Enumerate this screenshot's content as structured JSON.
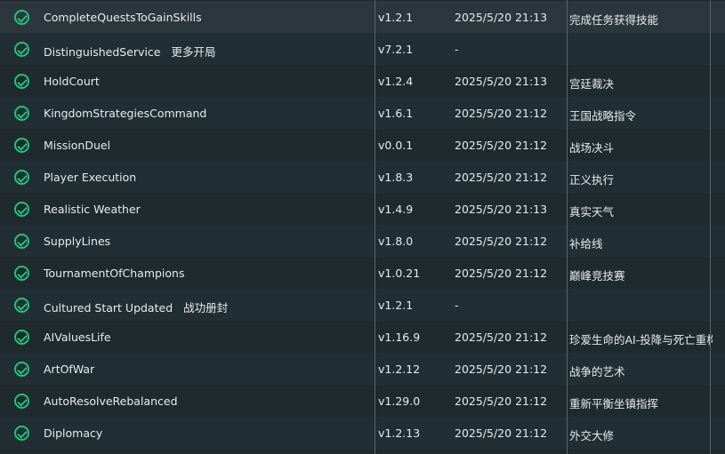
{
  "mods": [
    {
      "name": "CompleteQuestsToGainSkills",
      "extra": "",
      "version": "v1.2.1",
      "date": "2025/5/20 21:13",
      "desc": "完成任务获得技能"
    },
    {
      "name": "DistinguishedService",
      "extra": "更多开局",
      "version": "v7.2.1",
      "date": "-",
      "desc": ""
    },
    {
      "name": "HoldCourt",
      "extra": "",
      "version": "v1.2.4",
      "date": "2025/5/20 21:13",
      "desc": "宫廷裁决"
    },
    {
      "name": "KingdomStrategiesCommand",
      "extra": "",
      "version": "v1.6.1",
      "date": "2025/5/20 21:12",
      "desc": "王国战略指令"
    },
    {
      "name": "MissionDuel",
      "extra": "",
      "version": "v0.0.1",
      "date": "2025/5/20 21:12",
      "desc": "战场决斗"
    },
    {
      "name": "Player Execution",
      "extra": "",
      "version": "v1.8.3",
      "date": "2025/5/20 21:12",
      "desc": "正义执行"
    },
    {
      "name": "Realistic Weather",
      "extra": "",
      "version": "v1.4.9",
      "date": "2025/5/20 21:13",
      "desc": "真实天气"
    },
    {
      "name": "SupplyLines",
      "extra": "",
      "version": "v1.8.0",
      "date": "2025/5/20 21:12",
      "desc": "补给线"
    },
    {
      "name": "TournamentOfChampions",
      "extra": "",
      "version": "v1.0.21",
      "date": "2025/5/20 21:12",
      "desc": "巅峰竞技赛"
    },
    {
      "name": "Cultured Start Updated",
      "extra": "战功册封",
      "version": "v1.2.1",
      "date": "-",
      "desc": ""
    },
    {
      "name": "AIValuesLife",
      "extra": "",
      "version": "v1.16.9",
      "date": "2025/5/20 21:12",
      "desc": "珍爱生命的AI-投降与死亡重构"
    },
    {
      "name": "ArtOfWar",
      "extra": "",
      "version": "v1.2.12",
      "date": "2025/5/20 21:12",
      "desc": "战争的艺术"
    },
    {
      "name": "AutoResolveRebalanced",
      "extra": "",
      "version": "v1.29.0",
      "date": "2025/5/20 21:12",
      "desc": "重新平衡坐镇指挥"
    },
    {
      "name": "Diplomacy",
      "extra": "",
      "version": "v1.2.13",
      "date": "2025/5/20 21:12",
      "desc": "外交大修"
    }
  ],
  "colors": {
    "check": "#22c07a",
    "background": "#1e2a2e",
    "divider": "#56646a"
  }
}
